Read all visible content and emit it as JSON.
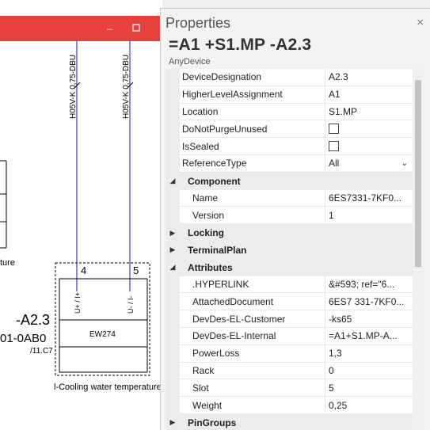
{
  "schematic": {
    "wire_labels": [
      "H05V-K 0,75-DBU",
      "H05V-K 0,75-DBU"
    ],
    "pin_numbers": [
      "4",
      "5"
    ],
    "pin_labels": [
      "U+ / I+",
      "U- / I-"
    ],
    "device_tag": "-A2.3",
    "device_part": "01-0AB0",
    "device_ref": "/11.C7",
    "terminal_label": "EW274",
    "caption": "l-Cooling water temperature",
    "left_caption": "ture",
    "window_maximize_icon": "maximize-icon",
    "colors": {
      "wire": "#1a1aa8",
      "titlebar": "#e8403a"
    }
  },
  "panel": {
    "title": "Properties",
    "close_icon": "×",
    "object_name": "=A1 +S1.MP -A2.3",
    "object_type": "AnyDevice",
    "properties": [
      {
        "kind": "prop",
        "name": "DeviceDesignation",
        "value": "A2.3"
      },
      {
        "kind": "prop",
        "name": "HigherLevelAssignment",
        "value": "A1"
      },
      {
        "kind": "prop",
        "name": "Location",
        "value": "S1.MP"
      },
      {
        "kind": "check",
        "name": "DoNotPurgeUnused",
        "value": ""
      },
      {
        "kind": "check",
        "name": "IsSealed",
        "value": ""
      },
      {
        "kind": "select",
        "name": "ReferenceType",
        "value": "All"
      },
      {
        "kind": "cat",
        "name": "Component",
        "expanded": true
      },
      {
        "kind": "sub",
        "name": "Name",
        "value": "6ES7331-7KF0..."
      },
      {
        "kind": "sub",
        "name": "Version",
        "value": "1"
      },
      {
        "kind": "cat",
        "name": "Locking",
        "expanded": false
      },
      {
        "kind": "cat",
        "name": "TerminalPlan",
        "expanded": false
      },
      {
        "kind": "cat",
        "name": "Attributes",
        "expanded": true
      },
      {
        "kind": "sub",
        "name": ".HYPERLINK",
        "value": "&#593; ref=\"6..."
      },
      {
        "kind": "sub",
        "name": "AttachedDocument",
        "value": "6ES7 331-7KF0..."
      },
      {
        "kind": "sub",
        "name": "DevDes-EL-Customer",
        "value": "-ks65"
      },
      {
        "kind": "sub",
        "name": "DevDes-EL-Internal",
        "value": "=A1+S1.MP-A..."
      },
      {
        "kind": "sub",
        "name": "PowerLoss",
        "value": "1,3"
      },
      {
        "kind": "sub",
        "name": "Rack",
        "value": "0"
      },
      {
        "kind": "sub",
        "name": "Slot",
        "value": "5"
      },
      {
        "kind": "sub",
        "name": "Weight",
        "value": "0,25"
      },
      {
        "kind": "cat",
        "name": "PinGroups",
        "expanded": false
      }
    ],
    "scroll_fraction": 0.55
  }
}
